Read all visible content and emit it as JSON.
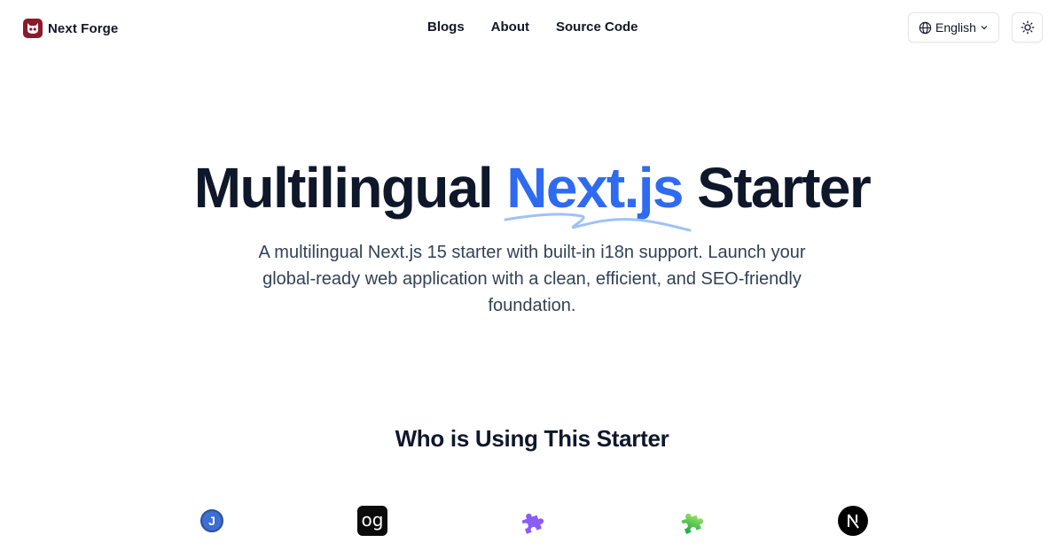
{
  "header": {
    "brand_name": "Next Forge",
    "nav": [
      {
        "label": "Blogs"
      },
      {
        "label": "About"
      },
      {
        "label": "Source Code"
      }
    ],
    "language": {
      "label": "English"
    }
  },
  "hero": {
    "title_before": "Multilingual ",
    "title_accent": "Next.js",
    "title_after": " Starter",
    "subtitle": "A multilingual Next.js 15 starter with built-in i18n support. Launch your global-ready web application with a clean, efficient, and SEO-friendly foundation."
  },
  "users": {
    "title": "Who is Using This Starter",
    "logos": [
      {
        "icon": "j-letter-icon",
        "text": "J"
      },
      {
        "icon": "og-icon",
        "text": "og"
      },
      {
        "icon": "purple-puzzle-icon"
      },
      {
        "icon": "green-puzzle-icon"
      },
      {
        "icon": "nextjs-icon"
      }
    ]
  },
  "colors": {
    "accent": "#2f6bf0",
    "brand": "#8b1a2b",
    "text": "#0f172a"
  }
}
